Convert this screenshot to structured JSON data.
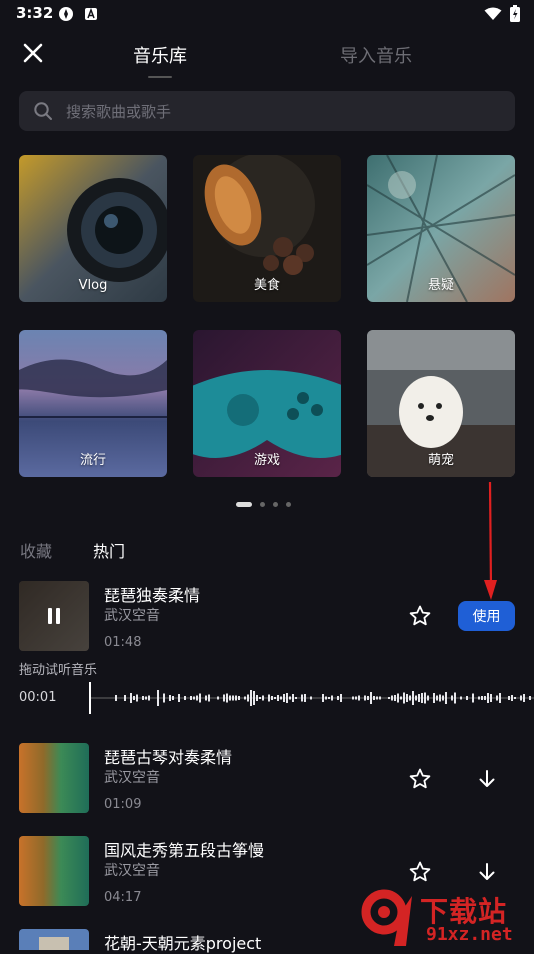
{
  "status_bar": {
    "time": "3:32"
  },
  "header": {
    "tabs": [
      {
        "label": "音乐库",
        "active": true
      },
      {
        "label": "导入音乐",
        "active": false
      }
    ]
  },
  "search": {
    "placeholder": "搜索歌曲或歌手"
  },
  "categories": [
    {
      "label": "Vlog"
    },
    {
      "label": "美食"
    },
    {
      "label": "悬疑"
    },
    {
      "label": "流行"
    },
    {
      "label": "游戏"
    },
    {
      "label": "萌宠"
    }
  ],
  "carousel": {
    "pages": 4,
    "current": 1
  },
  "list_tabs": [
    {
      "label": "收藏",
      "active": false
    },
    {
      "label": "热门",
      "active": true
    }
  ],
  "tracks": [
    {
      "title": "琵琶独奏柔情",
      "artist": "武汉空音",
      "duration": "01:48",
      "state": "playing",
      "action": "使用"
    },
    {
      "title": "琵琶古琴对奏柔情",
      "artist": "武汉空音",
      "duration": "01:09"
    },
    {
      "title": "国风走秀第五段古筝慢",
      "artist": "武汉空音",
      "duration": "04:17"
    },
    {
      "title": "花朝-天朝元素project"
    }
  ],
  "player": {
    "hint": "拖动试听音乐",
    "current_time": "00:01"
  },
  "watermark": {
    "text": "下载站",
    "domain": "91xz.net"
  },
  "colors": {
    "background": "#121218",
    "accent": "#1f5fd6",
    "annotation_arrow": "#e02020"
  }
}
